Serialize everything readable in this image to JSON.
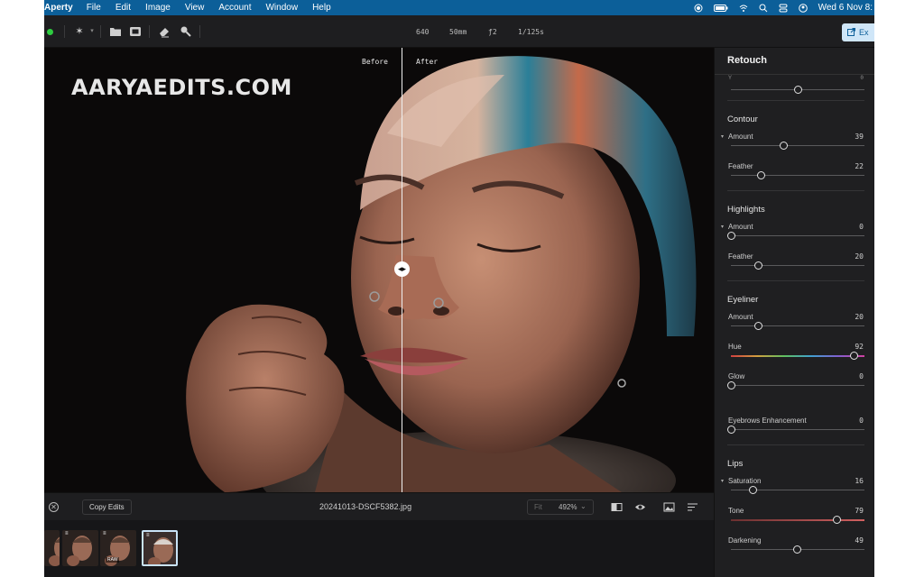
{
  "menubar": {
    "app_name": "Aperty",
    "menus": [
      "File",
      "Edit",
      "Image",
      "View",
      "Account",
      "Window",
      "Help"
    ],
    "datetime": "Wed 6 Nov  8:",
    "status_icons": [
      "record-icon",
      "battery-icon",
      "wifi-icon",
      "search-icon",
      "control-center-icon",
      "user-icon"
    ]
  },
  "toolbar": {
    "exif": {
      "iso": "640",
      "focal": "50mm",
      "aperture": "ƒ2",
      "shutter": "1/125s"
    },
    "export_label": "Ex",
    "tools": [
      "magic-wand-icon",
      "folder-icon",
      "presets-icon",
      "eraser-icon",
      "brush-icon"
    ]
  },
  "canvas": {
    "watermark": "AARYAEDITS.COM",
    "before_label": "Before",
    "after_label": "After",
    "split_handle": "◂▸",
    "split_position": 0.535
  },
  "panel": {
    "title": "Retouch",
    "top_row": {
      "label": "Y",
      "value": "0",
      "level": 0.5
    },
    "sections": [
      {
        "title": "Contour",
        "rows": [
          {
            "label": "Amount",
            "value": "39",
            "level": 0.39,
            "expanded": true
          },
          {
            "label": "Feather",
            "value": "22",
            "level": 0.22
          }
        ]
      },
      {
        "title": "Highlights",
        "rows": [
          {
            "label": "Amount",
            "value": "0",
            "level": 0.0,
            "expanded": true
          },
          {
            "label": "Feather",
            "value": "20",
            "level": 0.2
          }
        ]
      },
      {
        "title": "Eyeliner",
        "rows": [
          {
            "label": "Amount",
            "value": "20",
            "level": 0.2
          },
          {
            "label": "Hue",
            "value": "92",
            "level": 0.92,
            "rainbow": true
          },
          {
            "label": "Glow",
            "value": "0",
            "level": 0.0
          },
          {
            "label": "Eyebrows Enhancement",
            "value": "0",
            "level": 0.0,
            "gap": true
          }
        ]
      },
      {
        "title": "Lips",
        "rows": [
          {
            "label": "Saturation",
            "value": "16",
            "level": 0.16,
            "expanded": true
          },
          {
            "label": "Tone",
            "value": "79",
            "level": 0.79,
            "tone": true
          },
          {
            "label": "Darkening",
            "value": "49",
            "level": 0.49
          }
        ]
      }
    ]
  },
  "bottombar": {
    "copy_label": "Copy Edits",
    "file_name": "20241013-DSCF5382.jpg",
    "zoom_fit": "Fit",
    "zoom_value": "492%",
    "zoom_caret": "⌄",
    "icons": [
      "compare-icon",
      "eye-icon",
      "image-icon",
      "sort-icon"
    ]
  },
  "filmstrip": {
    "items": [
      {
        "badge": "",
        "tag": ""
      },
      {
        "badge": "≡",
        "tag": ""
      },
      {
        "badge": "≡",
        "tag": "RAW"
      },
      {
        "badge": "≡",
        "tag": "",
        "selected": true
      }
    ]
  }
}
